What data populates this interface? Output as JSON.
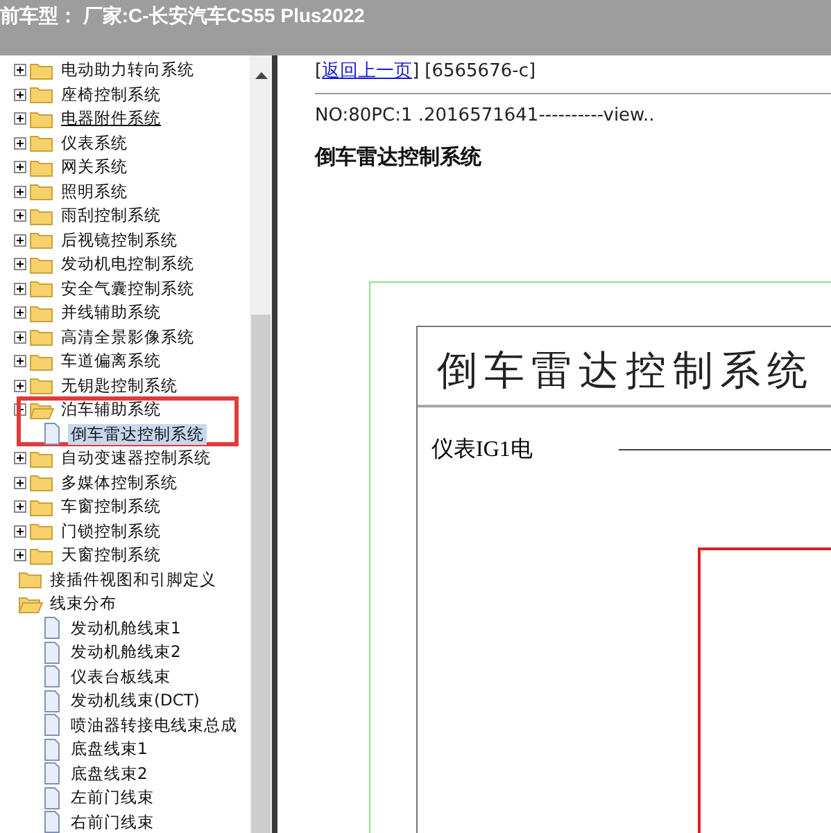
{
  "header": {
    "title": "前车型：  厂家:C-长安汽车CS55 Plus2022"
  },
  "tree": [
    {
      "children": [
        {
          "label": "电动助力转向系统",
          "kind": "folder",
          "expanded": false,
          "has_children": true
        },
        {
          "label": "座椅控制系统",
          "kind": "folder",
          "expanded": false,
          "has_children": true
        },
        {
          "label": "电器附件系统",
          "kind": "folder",
          "expanded": false,
          "has_children": true,
          "hovered": true
        },
        {
          "label": "仪表系统",
          "kind": "folder",
          "expanded": false,
          "has_children": true
        },
        {
          "label": "网关系统",
          "kind": "folder",
          "expanded": false,
          "has_children": true
        },
        {
          "label": "照明系统",
          "kind": "folder",
          "expanded": false,
          "has_children": true
        },
        {
          "label": "雨刮控制系统",
          "kind": "folder",
          "expanded": false,
          "has_children": true
        },
        {
          "label": "后视镜控制系统",
          "kind": "folder",
          "expanded": false,
          "has_children": true
        },
        {
          "label": "发动机电控制系统",
          "kind": "folder",
          "expanded": false,
          "has_children": true
        },
        {
          "label": "安全气囊控制系统",
          "kind": "folder",
          "expanded": false,
          "has_children": true
        },
        {
          "label": "并线辅助系统",
          "kind": "folder",
          "expanded": false,
          "has_children": true
        },
        {
          "label": "高清全景影像系统",
          "kind": "folder",
          "expanded": false,
          "has_children": true
        },
        {
          "label": "车道偏离系统",
          "kind": "folder",
          "expanded": false,
          "has_children": true
        },
        {
          "label": "无钥匙控制系统",
          "kind": "folder",
          "expanded": false,
          "has_children": true
        },
        {
          "label": "泊车辅助系统",
          "kind": "folder",
          "expanded": true,
          "has_children": true,
          "marked": true,
          "children": [
            {
              "label": "倒车雷达控制系统",
              "kind": "document",
              "selected": true
            }
          ]
        },
        {
          "label": "自动变速器控制系统",
          "kind": "folder",
          "expanded": false,
          "has_children": true
        },
        {
          "label": "多媒体控制系统",
          "kind": "folder",
          "expanded": false,
          "has_children": true
        },
        {
          "label": "车窗控制系统",
          "kind": "folder",
          "expanded": false,
          "has_children": true
        },
        {
          "label": "门锁控制系统",
          "kind": "folder",
          "expanded": false,
          "has_children": true
        },
        {
          "label": "天窗控制系统",
          "kind": "folder",
          "expanded": false,
          "has_children": true
        }
      ]
    },
    {
      "label": "接插件视图和引脚定义",
      "kind": "folder",
      "expanded": false
    },
    {
      "label": "线束分布",
      "kind": "folder",
      "expanded": true,
      "children": [
        {
          "label": "发动机舱线束1",
          "kind": "document",
          "selected": false
        },
        {
          "label": "发动机舱线束2",
          "kind": "document",
          "selected": false
        },
        {
          "label": "仪表台板线束",
          "kind": "document",
          "selected": false
        },
        {
          "label": "发动机线束(DCT)",
          "kind": "document",
          "selected": false
        },
        {
          "label": "喷油器转接电线束总成",
          "kind": "document",
          "selected": false
        },
        {
          "label": "底盘线束1",
          "kind": "document",
          "selected": false
        },
        {
          "label": "底盘线束2",
          "kind": "document",
          "selected": false
        },
        {
          "label": "左前门线束",
          "kind": "document",
          "selected": false
        },
        {
          "label": "右前门线束",
          "kind": "document",
          "selected": false
        }
      ]
    }
  ],
  "content": {
    "back_link": {
      "open": "[",
      "text": "返回上一页",
      "close": "]"
    },
    "code": "[6565676-c]",
    "info": "NO:80PC:1 .2016571641----------view..",
    "heading": "倒车雷达控制系统",
    "diagram": {
      "title": "倒车雷达控制系统",
      "label": "仪表IG1电"
    }
  }
}
